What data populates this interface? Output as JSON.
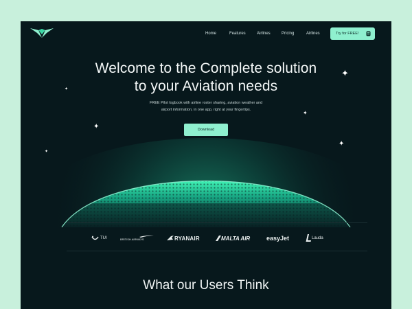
{
  "colors": {
    "page_bg": "#c8f0dc",
    "panel_bg": "#07181c",
    "accent": "#8ff0cf",
    "glow": "#2ee0a6"
  },
  "nav": {
    "logo_icon": "wing-logo-icon",
    "items": [
      "Home",
      "Features",
      "Airlines",
      "Pricing",
      "Airlines"
    ],
    "cta_label": "Try for FREE!",
    "cta_icon": "phone-icon"
  },
  "hero": {
    "title_line1": "Welcome to the Complete solution",
    "title_line2": "to your Aviation needs",
    "subtitle_line1": "FREE Pilot logbook with airline roster sharing, aviation weather and",
    "subtitle_line2": "airport information, in one app, right at your fingertips.",
    "download_label": "Download"
  },
  "brands": {
    "tui": "TUI",
    "british_airways": "BRITISH AIRWAYS",
    "ryanair": "RYANAIR",
    "malta_air": "MALTA AIR",
    "easyjet": "easyJet",
    "lauda": "Lauda"
  },
  "testimonials": {
    "heading": "What our Users Think"
  }
}
